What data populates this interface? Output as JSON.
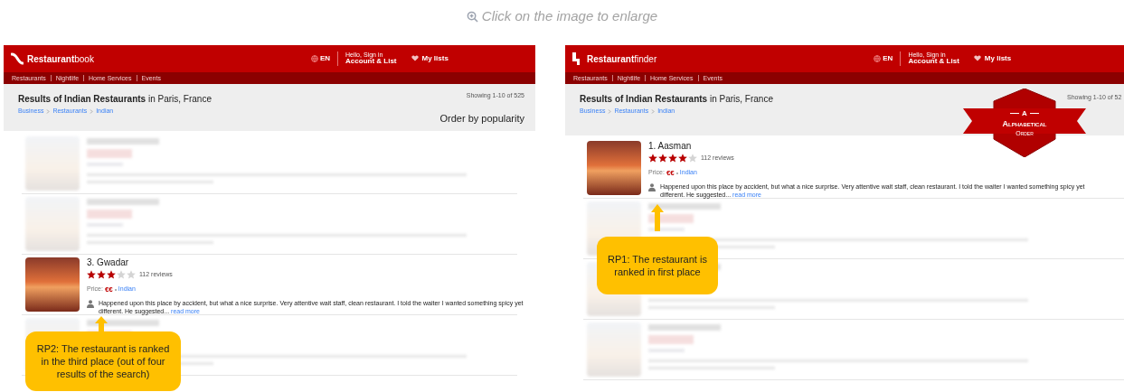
{
  "caption": {
    "text": "Click on the image to enlarge"
  },
  "panels": [
    {
      "brand": "Restaurant",
      "brand_suffix": "book",
      "language": "EN",
      "greeting": "Hello, Sign in",
      "account": "Account & List",
      "lists": "My lists",
      "nav": [
        "Restaurants",
        "Nightlife",
        "Home Services",
        "Events"
      ],
      "title": "**Results of Indian Restaurants** in Paris, France",
      "breadcrumbs": [
        "Business",
        "Restaurants",
        "Indian"
      ],
      "showing": "Showing 1-10 of 525",
      "order": "Order by popularity",
      "results": [
        {
          "kind": "blurred"
        },
        {
          "kind": "blurred"
        },
        {
          "kind": "featured",
          "name": "3. Gwadar",
          "stars": 3,
          "reviews": "112 reviews",
          "price_label": "Price:",
          "price": "€€",
          "cuisine": "Indian",
          "review": "Happened upon this place by accident, but what a nice surprise. Very attentive wait staff, clean restaurant. I told the waiter I wanted something spicy yet different. He suggested...",
          "read_more": "read more"
        },
        {
          "kind": "blurred"
        }
      ],
      "callout": "RP2: The restaurant is ranked in the third place (out of four results of the search)"
    },
    {
      "brand": "Restaurant",
      "brand_suffix": "finder",
      "language": "EN",
      "greeting": "Hello, Sign in",
      "account": "Account & List",
      "lists": "My lists",
      "nav": [
        "Restaurants",
        "Nightlife",
        "Home Services",
        "Events"
      ],
      "title": "**Results of Indian Restaurants** in Paris, France",
      "breadcrumbs": [
        "Business",
        "Restaurants",
        "Indian"
      ],
      "showing": "Showing 1-10 of 52",
      "badge": {
        "letter": "A",
        "title": "Alphabetical",
        "subtitle": "Order"
      },
      "results": [
        {
          "kind": "featured",
          "name": "1. Aasman",
          "stars": 4,
          "reviews": "112 reviews",
          "price_label": "Price:",
          "price": "€€",
          "cuisine": "Indian",
          "review": "Happened upon this place by accident, but what a nice surprise. Very attentive wait staff, clean restaurant. I told the waiter I wanted something spicy yet different. He suggested...",
          "read_more": "read more"
        },
        {
          "kind": "blurred"
        },
        {
          "kind": "blurred"
        },
        {
          "kind": "blurred"
        }
      ],
      "callout": "RP1: The restaurant is ranked in first place"
    }
  ]
}
